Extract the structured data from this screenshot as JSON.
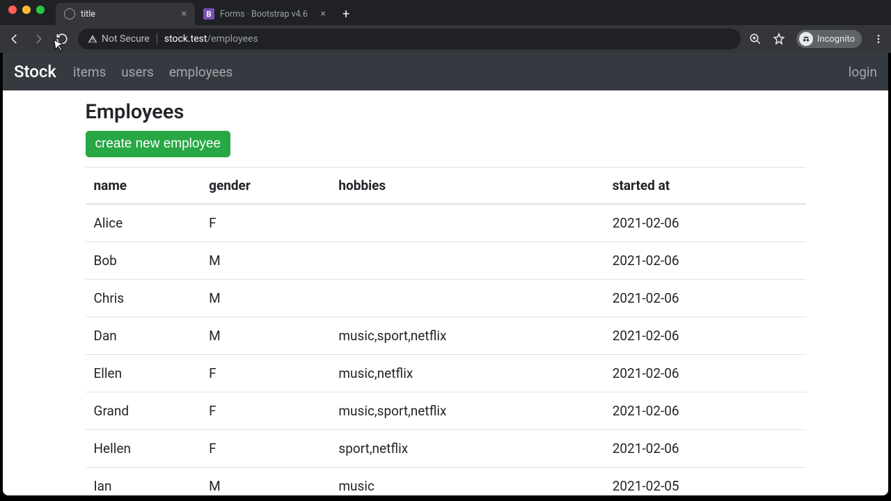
{
  "browser": {
    "tabs": [
      {
        "title": "title",
        "active": true
      },
      {
        "title": "Forms · Bootstrap v4.6",
        "active": false
      }
    ],
    "security_label": "Not Secure",
    "url_host": "stock.test",
    "url_path": "/employees",
    "incognito_label": "Incognito"
  },
  "navbar": {
    "brand": "Stock",
    "links": [
      "items",
      "users",
      "employees"
    ],
    "right_link": "login"
  },
  "page": {
    "title": "Employees",
    "create_button": "create new employee"
  },
  "table": {
    "headers": {
      "name": "name",
      "gender": "gender",
      "hobbies": "hobbies",
      "started": "started at"
    },
    "rows": [
      {
        "name": "Alice",
        "gender": "F",
        "hobbies": "",
        "started": "2021-02-06"
      },
      {
        "name": "Bob",
        "gender": "M",
        "hobbies": "",
        "started": "2021-02-06"
      },
      {
        "name": "Chris",
        "gender": "M",
        "hobbies": "",
        "started": "2021-02-06"
      },
      {
        "name": "Dan",
        "gender": "M",
        "hobbies": "music,sport,netflix",
        "started": "2021-02-06"
      },
      {
        "name": "Ellen",
        "gender": "F",
        "hobbies": "music,netflix",
        "started": "2021-02-06"
      },
      {
        "name": "Grand",
        "gender": "F",
        "hobbies": "music,sport,netflix",
        "started": "2021-02-06"
      },
      {
        "name": "Hellen",
        "gender": "F",
        "hobbies": "sport,netflix",
        "started": "2021-02-06"
      },
      {
        "name": "Ian",
        "gender": "M",
        "hobbies": "music",
        "started": "2021-02-05"
      }
    ]
  }
}
